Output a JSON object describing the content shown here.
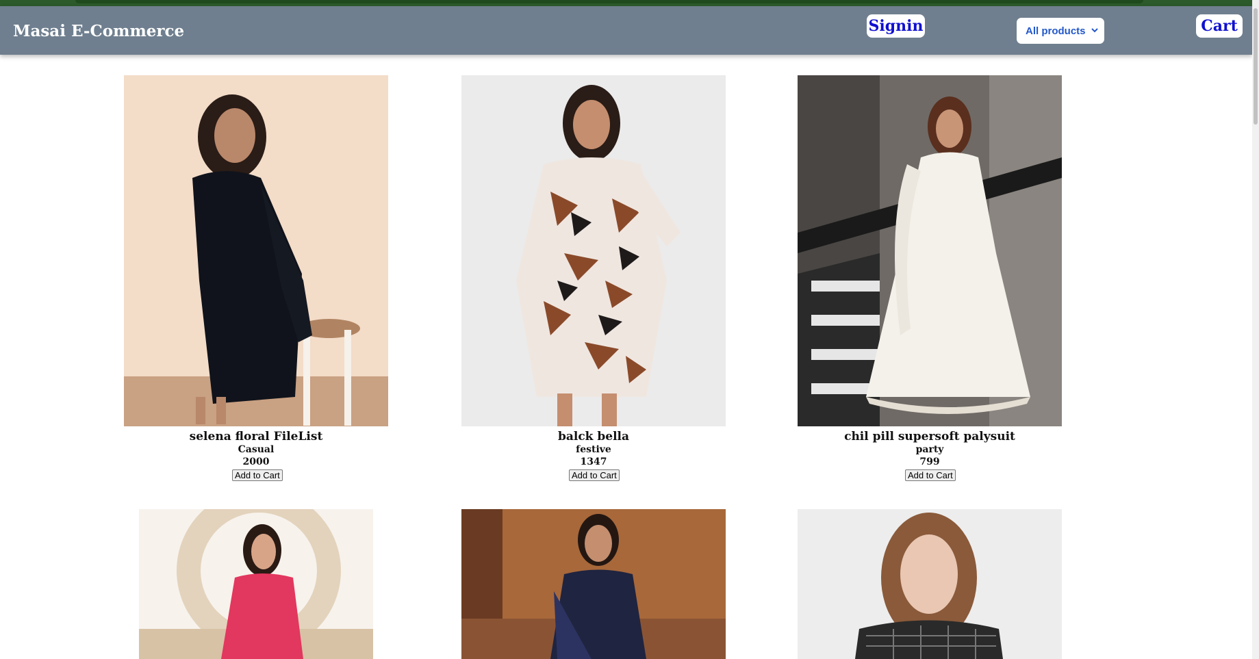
{
  "navbar": {
    "brand": "Masai E-Commerce",
    "signin_label": "Signin",
    "filter_selected": "All products",
    "cart_label": "Cart"
  },
  "products": [
    {
      "name": "selena floral FileList",
      "category": "Casual",
      "price": "2000",
      "button": "Add to Cart"
    },
    {
      "name": "balck bella",
      "category": "festive",
      "price": "1347",
      "button": "Add to Cart"
    },
    {
      "name": "chil pill supersoft palysuit",
      "category": "party",
      "price": "799",
      "button": "Add to Cart"
    }
  ],
  "colors": {
    "navbar_bg": "#6f7f8f",
    "top_strip": "#2c5a2a",
    "link_blue": "#1010d0",
    "select_text": "#2358c8"
  }
}
